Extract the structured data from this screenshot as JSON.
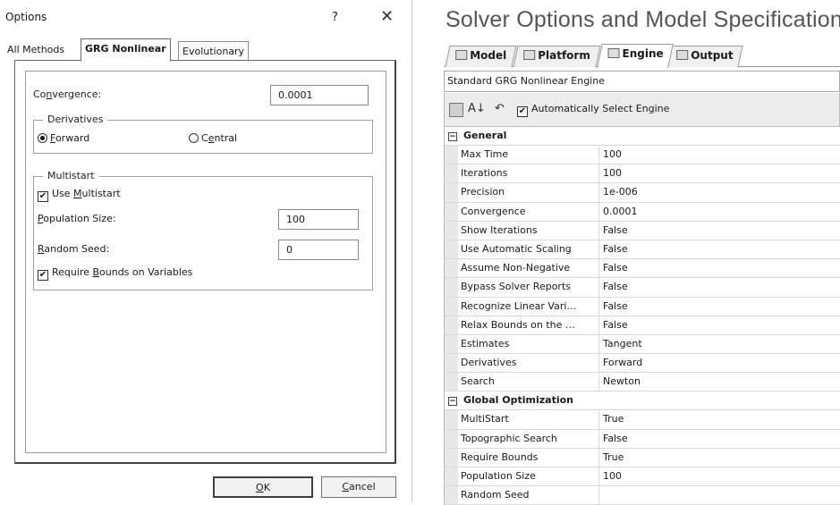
{
  "dialog": {
    "title": "Options",
    "help_glyph": "?",
    "close_glyph": "✕",
    "tabs": [
      "All Methods",
      "GRG Nonlinear",
      "Evolutionary"
    ],
    "convergence": {
      "label_pre": "Co",
      "label_u": "n",
      "label_post": "vergence:",
      "value": "0.0001"
    },
    "derivatives": {
      "group_title": "Derivatives",
      "forward": {
        "u": "F",
        "rest": "orward",
        "selected": true
      },
      "central": {
        "pre": "C",
        "u": "e",
        "rest": "ntral",
        "selected": false
      }
    },
    "multistart": {
      "group_title": "Multistart",
      "use_multistart": {
        "pre": "Use ",
        "u": "M",
        "rest": "ultistart",
        "checked": true
      },
      "population": {
        "u": "P",
        "rest": "opulation Size:",
        "value": "100"
      },
      "seed": {
        "u": "R",
        "rest": "andom Seed:",
        "value": "0"
      },
      "require_bounds": {
        "pre": "Require ",
        "u": "B",
        "rest": "ounds on Variables",
        "checked": true
      }
    },
    "ok": {
      "u": "O",
      "rest": "K"
    },
    "cancel": {
      "u": "C",
      "rest": "ancel"
    }
  },
  "solver": {
    "heading": "Solver Options and Model Specifications",
    "tabs": [
      "Model",
      "Platform",
      "Engine",
      "Output"
    ],
    "active_tab": "Engine",
    "engine": "Standard GRG Nonlinear Engine",
    "toolbar": {
      "auto_select_label": "Automatically Select Engine",
      "auto_select_checked": true,
      "sort_glyph": "A↓",
      "undo_glyph": "↶"
    },
    "categories": [
      {
        "name": "General",
        "properties": [
          {
            "name": "Max Time",
            "value": "100"
          },
          {
            "name": "Iterations",
            "value": "100"
          },
          {
            "name": "Precision",
            "value": "1e-006"
          },
          {
            "name": "Convergence",
            "value": "0.0001"
          },
          {
            "name": "Show Iterations",
            "value": "False"
          },
          {
            "name": "Use Automatic Scaling",
            "value": "False"
          },
          {
            "name": "Assume Non-Negative",
            "value": "False"
          },
          {
            "name": "Bypass Solver Reports",
            "value": "False"
          },
          {
            "name": "Recognize Linear Vari…",
            "value": "False"
          },
          {
            "name": "Relax Bounds on the …",
            "value": "False"
          },
          {
            "name": "Estimates",
            "value": "Tangent"
          },
          {
            "name": "Derivatives",
            "value": "Forward"
          },
          {
            "name": "Search",
            "value": "Newton"
          }
        ]
      },
      {
        "name": "Global Optimization",
        "properties": [
          {
            "name": "MultiStart",
            "value": "True"
          },
          {
            "name": "Topographic Search",
            "value": "False"
          },
          {
            "name": "Require Bounds",
            "value": "True"
          },
          {
            "name": "Population Size",
            "value": "100"
          },
          {
            "name": "Random Seed",
            "value": ""
          }
        ]
      }
    ]
  }
}
